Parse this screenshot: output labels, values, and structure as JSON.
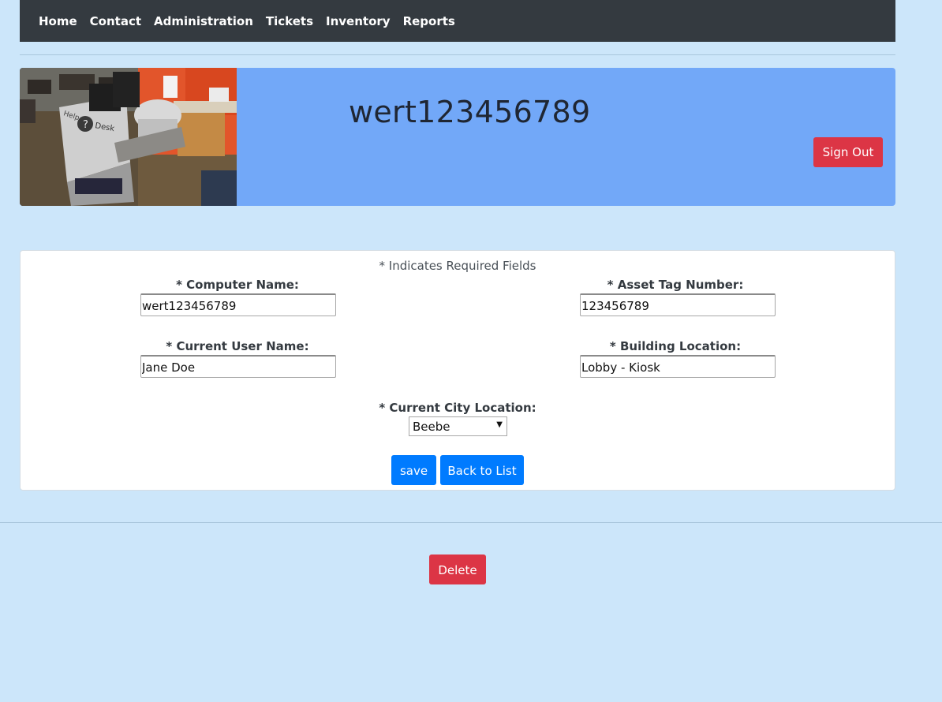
{
  "nav": {
    "items": [
      {
        "label": "Home"
      },
      {
        "label": "Contact"
      },
      {
        "label": "Administration"
      },
      {
        "label": "Tickets"
      },
      {
        "label": "Inventory"
      },
      {
        "label": "Reports"
      }
    ]
  },
  "banner": {
    "title": "wert123456789",
    "sign_out_label": "Sign Out",
    "photo_icon": "help-desk-photo",
    "photo_text_help": "Help",
    "photo_text_desk": "Desk"
  },
  "form": {
    "required_note": "* Indicates Required Fields",
    "computer_name_label": "* Computer Name:",
    "computer_name_value": "wert123456789",
    "asset_tag_label": "* Asset Tag Number:",
    "asset_tag_value": "123456789",
    "user_name_label": "* Current User Name:",
    "user_name_value": "Jane Doe",
    "building_label": "* Building Location:",
    "building_value": "Lobby - Kiosk",
    "city_label": "* Current City Location:",
    "city_value": "Beebe",
    "save_label": "save",
    "back_label": "Back to List"
  },
  "delete_label": "Delete",
  "colors": {
    "page_bg": "#cce6fa",
    "navbar_bg": "#343a40",
    "banner_bg": "#72a8f8",
    "primary": "#007bff",
    "danger": "#dc3545"
  }
}
